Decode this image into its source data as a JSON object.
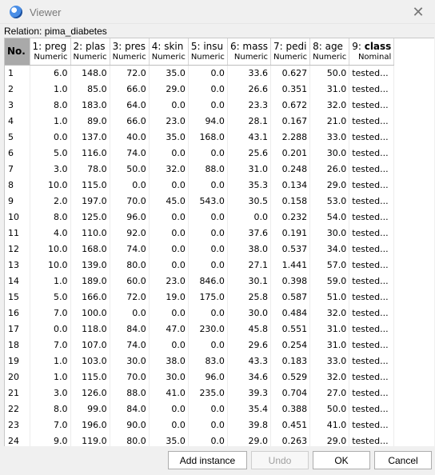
{
  "window": {
    "title": "Viewer"
  },
  "relation_label": "Relation: pima_diabetes",
  "columns": [
    {
      "name": "No.",
      "type": ""
    },
    {
      "name": "1: preg",
      "type": "Numeric"
    },
    {
      "name": "2: plas",
      "type": "Numeric"
    },
    {
      "name": "3: pres",
      "type": "Numeric"
    },
    {
      "name": "4: skin",
      "type": "Numeric"
    },
    {
      "name": "5: insu",
      "type": "Numeric"
    },
    {
      "name": "6: mass",
      "type": "Numeric"
    },
    {
      "name": "7: pedi",
      "type": "Numeric"
    },
    {
      "name": "8: age",
      "type": "Numeric"
    },
    {
      "name": "9: class",
      "type": "Nominal"
    }
  ],
  "rows": [
    [
      "1",
      "6.0",
      "148.0",
      "72.0",
      "35.0",
      "0.0",
      "33.6",
      "0.627",
      "50.0",
      "tested..."
    ],
    [
      "2",
      "1.0",
      "85.0",
      "66.0",
      "29.0",
      "0.0",
      "26.6",
      "0.351",
      "31.0",
      "tested..."
    ],
    [
      "3",
      "8.0",
      "183.0",
      "64.0",
      "0.0",
      "0.0",
      "23.3",
      "0.672",
      "32.0",
      "tested..."
    ],
    [
      "4",
      "1.0",
      "89.0",
      "66.0",
      "23.0",
      "94.0",
      "28.1",
      "0.167",
      "21.0",
      "tested..."
    ],
    [
      "5",
      "0.0",
      "137.0",
      "40.0",
      "35.0",
      "168.0",
      "43.1",
      "2.288",
      "33.0",
      "tested..."
    ],
    [
      "6",
      "5.0",
      "116.0",
      "74.0",
      "0.0",
      "0.0",
      "25.6",
      "0.201",
      "30.0",
      "tested..."
    ],
    [
      "7",
      "3.0",
      "78.0",
      "50.0",
      "32.0",
      "88.0",
      "31.0",
      "0.248",
      "26.0",
      "tested..."
    ],
    [
      "8",
      "10.0",
      "115.0",
      "0.0",
      "0.0",
      "0.0",
      "35.3",
      "0.134",
      "29.0",
      "tested..."
    ],
    [
      "9",
      "2.0",
      "197.0",
      "70.0",
      "45.0",
      "543.0",
      "30.5",
      "0.158",
      "53.0",
      "tested..."
    ],
    [
      "10",
      "8.0",
      "125.0",
      "96.0",
      "0.0",
      "0.0",
      "0.0",
      "0.232",
      "54.0",
      "tested..."
    ],
    [
      "11",
      "4.0",
      "110.0",
      "92.0",
      "0.0",
      "0.0",
      "37.6",
      "0.191",
      "30.0",
      "tested..."
    ],
    [
      "12",
      "10.0",
      "168.0",
      "74.0",
      "0.0",
      "0.0",
      "38.0",
      "0.537",
      "34.0",
      "tested..."
    ],
    [
      "13",
      "10.0",
      "139.0",
      "80.0",
      "0.0",
      "0.0",
      "27.1",
      "1.441",
      "57.0",
      "tested..."
    ],
    [
      "14",
      "1.0",
      "189.0",
      "60.0",
      "23.0",
      "846.0",
      "30.1",
      "0.398",
      "59.0",
      "tested..."
    ],
    [
      "15",
      "5.0",
      "166.0",
      "72.0",
      "19.0",
      "175.0",
      "25.8",
      "0.587",
      "51.0",
      "tested..."
    ],
    [
      "16",
      "7.0",
      "100.0",
      "0.0",
      "0.0",
      "0.0",
      "30.0",
      "0.484",
      "32.0",
      "tested..."
    ],
    [
      "17",
      "0.0",
      "118.0",
      "84.0",
      "47.0",
      "230.0",
      "45.8",
      "0.551",
      "31.0",
      "tested..."
    ],
    [
      "18",
      "7.0",
      "107.0",
      "74.0",
      "0.0",
      "0.0",
      "29.6",
      "0.254",
      "31.0",
      "tested..."
    ],
    [
      "19",
      "1.0",
      "103.0",
      "30.0",
      "38.0",
      "83.0",
      "43.3",
      "0.183",
      "33.0",
      "tested..."
    ],
    [
      "20",
      "1.0",
      "115.0",
      "70.0",
      "30.0",
      "96.0",
      "34.6",
      "0.529",
      "32.0",
      "tested..."
    ],
    [
      "21",
      "3.0",
      "126.0",
      "88.0",
      "41.0",
      "235.0",
      "39.3",
      "0.704",
      "27.0",
      "tested..."
    ],
    [
      "22",
      "8.0",
      "99.0",
      "84.0",
      "0.0",
      "0.0",
      "35.4",
      "0.388",
      "50.0",
      "tested..."
    ],
    [
      "23",
      "7.0",
      "196.0",
      "90.0",
      "0.0",
      "0.0",
      "39.8",
      "0.451",
      "41.0",
      "tested..."
    ],
    [
      "24",
      "9.0",
      "119.0",
      "80.0",
      "35.0",
      "0.0",
      "29.0",
      "0.263",
      "29.0",
      "tested..."
    ]
  ],
  "buttons": {
    "add_instance": "Add instance",
    "undo": "Undo",
    "ok": "OK",
    "cancel": "Cancel"
  },
  "icons": {
    "app": "weka-bird-icon",
    "close": "close-icon"
  }
}
